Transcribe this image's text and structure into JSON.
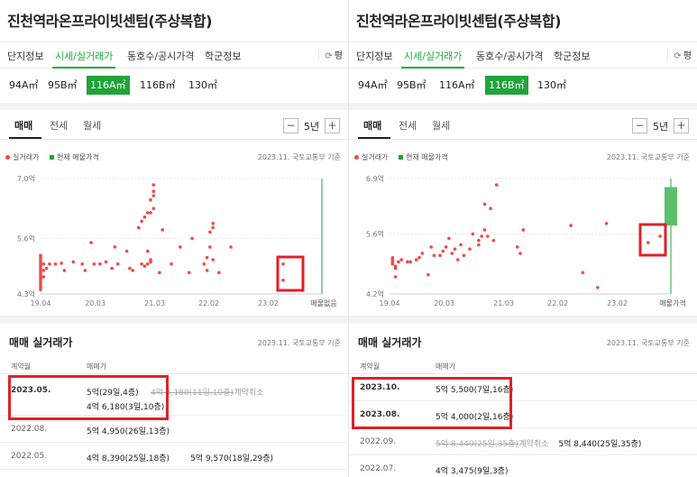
{
  "left": {
    "title": "진천역라온프라이빗센텀(주상복합)",
    "tabs": [
      "단지정보",
      "시세/실거래가",
      "동호수/공시가격",
      "학군정보"
    ],
    "py_label": "평",
    "sizes": [
      "94A㎡",
      "95B㎡",
      "116A㎡",
      "116B㎡",
      "130㎡"
    ],
    "active_size": "116A㎡",
    "deal_tabs": [
      "매매",
      "전세",
      "월세"
    ],
    "zoom": "5년",
    "legend_real": "실거래가",
    "legend_listing": "현재 매물가격",
    "source": "2023.11. 국토교통부 기준",
    "now_label": "매물없음",
    "section_title": "매매 실거래가",
    "col_date": "계약월",
    "col_price": "매매가",
    "rows": [
      {
        "date": "2023.05.",
        "l1a": "5억(29일,4층)",
        "l1strike": "4억 5,180(11일,10층)",
        "l1cancel": "계약취소",
        "l2": "4억 6,180(3일,10층)"
      },
      {
        "date": "2022.08.",
        "l1a": "5억 4,950(26일,13층)"
      },
      {
        "date": "2022.05.",
        "l1a": "4억 8,390(25일,18층)",
        "l1b": "5억 9,570(18일,29층)"
      }
    ]
  },
  "right": {
    "title": "진천역라온프라이빗센텀(주상복합)",
    "tabs": [
      "단지정보",
      "시세/실거래가",
      "동호수/공시가격",
      "학군정보"
    ],
    "py_label": "평",
    "sizes": [
      "94A㎡",
      "95B㎡",
      "116A㎡",
      "116B㎡",
      "130㎡"
    ],
    "active_size": "116B㎡",
    "deal_tabs": [
      "매매",
      "전세",
      "월세"
    ],
    "zoom": "5년",
    "legend_real": "실거래가",
    "legend_listing": "현재 매물가격",
    "source": "2023.11. 국토교통부 기준",
    "now_label": "매물가격",
    "section_title": "매매 실거래가",
    "col_date": "계약월",
    "col_price": "매매가",
    "rows": [
      {
        "date": "2023.10.",
        "l1a": "5억 5,500(7일,16층)"
      },
      {
        "date": "2023.08.",
        "l1a": "5억 4,000(2일,16층)"
      },
      {
        "date": "2022.09.",
        "l1strike": "5억 8,440(25일,35층)",
        "l1cancel": "계약취소",
        "l1b": "5억 8,440(25일,35층)"
      },
      {
        "date": "2022.07.",
        "l1a": "4억 3,475(9일,3층)"
      }
    ]
  },
  "chart_data": [
    {
      "type": "scatter",
      "title": "",
      "xlabel": "",
      "ylabel": "",
      "y_ticks": [
        "7.0억",
        "5.6억",
        "4.3억"
      ],
      "y_tick_values": [
        7.0,
        5.6,
        4.3
      ],
      "ylim": [
        4.3,
        7.0
      ],
      "x_ticks": [
        "19.04",
        "20.03",
        "21.03",
        "22.02",
        "23.02"
      ],
      "x_tick_values": [
        2019.25,
        2020.17,
        2021.17,
        2022.08,
        2023.08
      ],
      "xlim": [
        2019.25,
        2024.3
      ],
      "legend": "top-left",
      "colors": {
        "real": "#ef4a4a",
        "listing": "#21a33a"
      },
      "series": [
        {
          "name": "실거래가",
          "points": [
            [
              2019.25,
              4.55
            ],
            [
              2019.25,
              4.6
            ],
            [
              2019.25,
              4.65
            ],
            [
              2019.25,
              4.7
            ],
            [
              2019.25,
              4.75
            ],
            [
              2019.25,
              4.8
            ],
            [
              2019.25,
              4.85
            ],
            [
              2019.25,
              4.9
            ],
            [
              2019.25,
              4.95
            ],
            [
              2019.25,
              5.0
            ],
            [
              2019.25,
              5.05
            ],
            [
              2019.25,
              5.1
            ],
            [
              2019.25,
              5.15
            ],
            [
              2019.25,
              5.2
            ],
            [
              2019.25,
              4.5
            ],
            [
              2019.25,
              4.45
            ],
            [
              2019.25,
              4.4
            ],
            [
              2019.3,
              4.7
            ],
            [
              2019.3,
              4.85
            ],
            [
              2019.3,
              5.0
            ],
            [
              2019.35,
              4.9
            ],
            [
              2019.4,
              5.0
            ],
            [
              2019.5,
              5.0
            ],
            [
              2019.6,
              5.02
            ],
            [
              2019.65,
              4.85
            ],
            [
              2019.8,
              5.05
            ],
            [
              2019.95,
              5.0
            ],
            [
              2020.0,
              4.85
            ],
            [
              2020.1,
              5.5
            ],
            [
              2020.15,
              5.0
            ],
            [
              2020.25,
              5.0
            ],
            [
              2020.35,
              5.05
            ],
            [
              2020.45,
              4.9
            ],
            [
              2020.5,
              5.4
            ],
            [
              2020.55,
              5.0
            ],
            [
              2020.7,
              5.3
            ],
            [
              2020.75,
              4.9
            ],
            [
              2020.8,
              4.85
            ],
            [
              2020.95,
              5.0
            ],
            [
              2021.05,
              5.3
            ],
            [
              2021.05,
              5.0
            ],
            [
              2020.9,
              5.85
            ],
            [
              2020.95,
              6.0
            ],
            [
              2021.0,
              6.1
            ],
            [
              2021.05,
              6.2
            ],
            [
              2021.1,
              6.2
            ],
            [
              2021.15,
              6.3
            ],
            [
              2021.1,
              6.5
            ],
            [
              2021.15,
              6.6
            ],
            [
              2021.15,
              6.7
            ],
            [
              2021.15,
              6.85
            ],
            [
              2021.1,
              5.05
            ],
            [
              2021.1,
              5.1
            ],
            [
              2021.0,
              4.95
            ],
            [
              2021.25,
              4.8
            ],
            [
              2021.3,
              5.8
            ],
            [
              2021.45,
              5.0
            ],
            [
              2021.6,
              5.4
            ],
            [
              2021.75,
              4.8
            ],
            [
              2021.8,
              5.6
            ],
            [
              2022.0,
              5.0
            ],
            [
              2022.05,
              4.85
            ],
            [
              2022.05,
              5.15
            ],
            [
              2022.1,
              5.4
            ],
            [
              2022.1,
              5.75
            ],
            [
              2022.15,
              5.85
            ],
            [
              2022.15,
              5.95
            ],
            [
              2022.15,
              5.1
            ],
            [
              2022.25,
              4.8
            ],
            [
              2022.45,
              5.4
            ],
            [
              2023.33,
              5.0
            ],
            [
              2023.33,
              4.62
            ]
          ]
        }
      ]
    },
    {
      "type": "scatter",
      "title": "",
      "xlabel": "",
      "ylabel": "",
      "y_ticks": [
        "6.9억",
        "5.6억",
        "4.2억"
      ],
      "y_tick_values": [
        6.9,
        5.6,
        4.2
      ],
      "ylim": [
        4.2,
        6.9
      ],
      "x_ticks": [
        "19.04",
        "20.03",
        "21.03",
        "22.02",
        "23.02"
      ],
      "x_tick_values": [
        2019.25,
        2020.17,
        2021.17,
        2022.08,
        2023.08
      ],
      "xlim": [
        2019.25,
        2024.3
      ],
      "legend": "top-left",
      "colors": {
        "real": "#ef4a4a",
        "listing": "#21a33a"
      },
      "series": [
        {
          "name": "실거래가",
          "points": [
            [
              2019.3,
              4.9
            ],
            [
              2019.3,
              4.95
            ],
            [
              2019.3,
              5.0
            ],
            [
              2019.3,
              5.05
            ],
            [
              2019.35,
              4.85
            ],
            [
              2019.35,
              4.8
            ],
            [
              2019.4,
              4.95
            ],
            [
              2019.45,
              5.0
            ],
            [
              2019.55,
              4.95
            ],
            [
              2019.6,
              4.95
            ],
            [
              2019.7,
              5.0
            ],
            [
              2019.75,
              5.05
            ],
            [
              2019.8,
              5.15
            ],
            [
              2019.35,
              4.6
            ],
            [
              2019.9,
              4.65
            ],
            [
              2019.95,
              5.3
            ],
            [
              2020.0,
              5.1
            ],
            [
              2020.1,
              5.1
            ],
            [
              2020.15,
              5.2
            ],
            [
              2020.2,
              5.3
            ],
            [
              2020.25,
              5.5
            ],
            [
              2020.3,
              5.15
            ],
            [
              2020.35,
              5.25
            ],
            [
              2020.4,
              5.0
            ],
            [
              2020.45,
              5.35
            ],
            [
              2020.5,
              5.1
            ],
            [
              2020.6,
              5.25
            ],
            [
              2020.65,
              5.6
            ],
            [
              2020.75,
              5.35
            ],
            [
              2020.75,
              5.45
            ],
            [
              2020.8,
              5.55
            ],
            [
              2020.85,
              5.7
            ],
            [
              2020.85,
              6.3
            ],
            [
              2020.9,
              5.55
            ],
            [
              2020.95,
              6.2
            ],
            [
              2021.0,
              5.45
            ],
            [
              2021.05,
              6.75
            ],
            [
              2021.4,
              5.3
            ],
            [
              2021.45,
              5.15
            ],
            [
              2021.5,
              5.7
            ],
            [
              2022.3,
              5.8
            ],
            [
              2022.5,
              4.7
            ],
            [
              2022.75,
              4.35
            ],
            [
              2022.9,
              5.85
            ],
            [
              2023.6,
              5.4
            ],
            [
              2023.8,
              5.55
            ]
          ]
        },
        {
          "name": "현재 매물가격",
          "range": [
            5.8,
            6.7
          ]
        }
      ]
    }
  ]
}
